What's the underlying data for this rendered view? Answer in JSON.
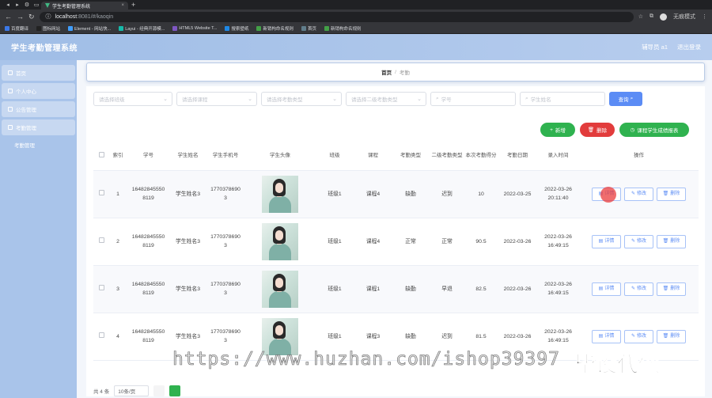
{
  "browser": {
    "tab_title": "学生考勤管理系统",
    "url_host": "localhost",
    "url_rest": ":8081/#/kaoqin",
    "profile_label": "无痕模式",
    "bookmarks": [
      {
        "label": "百度翻译",
        "color": "#3b78e7"
      },
      {
        "label": "图标网站",
        "color": "#222222"
      },
      {
        "label": "Element - 网站快...",
        "color": "#409eff"
      },
      {
        "label": "Layui - 经典开源模...",
        "color": "#16baaa"
      },
      {
        "label": "HTML5 Website T...",
        "color": "#7e57c2"
      },
      {
        "label": "搜索壁纸",
        "color": "#1e88e5"
      },
      {
        "label": "新销构命名规则",
        "color": "#43a047"
      },
      {
        "label": "首页",
        "color": "#607d8b"
      },
      {
        "label": "新销构命名规则",
        "color": "#43a047"
      }
    ]
  },
  "header": {
    "brand": "学生考勤管理系统",
    "user": "辅导员 a1",
    "logout": "退出登录"
  },
  "sidebar": {
    "items": [
      {
        "label": "首页"
      },
      {
        "label": "个人中心"
      },
      {
        "label": "公告管理"
      },
      {
        "label": "考勤管理"
      }
    ],
    "sub": "考勤管理"
  },
  "breadcrumb": {
    "home": "首页",
    "sep": "/",
    "current": "考勤"
  },
  "filters": {
    "class_placeholder": "请选择班级",
    "course_placeholder": "请选择课程",
    "type_placeholder": "请选择考勤类型",
    "type2_placeholder": "请选择二级考勤类型",
    "student_no_placeholder": "学号",
    "student_name_placeholder": "学生姓名",
    "query_label": "查询"
  },
  "actions": {
    "add": "新增",
    "delete": "删除",
    "report": "课程学生成绩报表"
  },
  "table": {
    "headers": [
      "索引",
      "学号",
      "学生姓名",
      "学生手机号",
      "学生头像",
      "班级",
      "课程",
      "考勤类型",
      "二级考勤类型",
      "本次考勤得分",
      "考勤日期",
      "录入时间",
      "操作"
    ],
    "rows": [
      {
        "index": "1",
        "no": "164828455508119",
        "name": "学生姓名3",
        "phone": "17703786903",
        "class": "班级1",
        "course": "课程4",
        "type": "缺勤",
        "type2": "迟到",
        "score": "10",
        "date": "2022-03-25",
        "time": "2022-03-26 20:11:40"
      },
      {
        "index": "2",
        "no": "164828455508119",
        "name": "学生姓名3",
        "phone": "17703786903",
        "class": "班级1",
        "course": "课程4",
        "type": "正常",
        "type2": "正常",
        "score": "90.5",
        "date": "2022-03-26",
        "time": "2022-03-26 16:49:15"
      },
      {
        "index": "3",
        "no": "164828455508119",
        "name": "学生姓名3",
        "phone": "17703786903",
        "class": "班级1",
        "course": "课程1",
        "type": "缺勤",
        "type2": "早退",
        "score": "82.5",
        "date": "2022-03-26",
        "time": "2022-03-26 16:49:15"
      },
      {
        "index": "4",
        "no": "164828455508119",
        "name": "学生姓名3",
        "phone": "17703786903",
        "class": "班级1",
        "course": "课程3",
        "type": "缺勤",
        "type2": "迟到",
        "score": "81.5",
        "date": "2022-03-26",
        "time": "2022-03-26 16:49:15"
      }
    ],
    "op_detail": "详情",
    "op_edit": "修改",
    "op_delete": "删除"
  },
  "pager": {
    "total": "共 4 条",
    "page_size": "10条/页"
  },
  "watermark": {
    "url": "https://www.huzhan.com/ishop39397",
    "text": "毕设代做"
  }
}
